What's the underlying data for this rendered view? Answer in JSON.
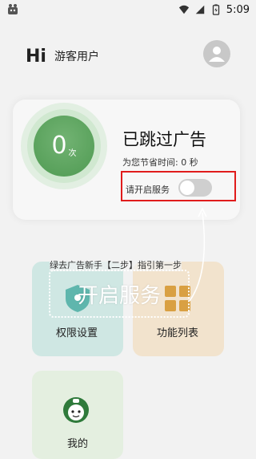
{
  "status_bar": {
    "time": "5:09"
  },
  "header": {
    "greeting": "Hi",
    "username": "游客用户"
  },
  "stats": {
    "count": "0",
    "count_unit": "次",
    "title": "已跳过广告",
    "saved_time": "为您节省时间: 0 秒",
    "service_label": "请开启服务",
    "service_enabled": false
  },
  "guide": {
    "step_text": "绿去广告新手【二步】指引第一步",
    "button_label": "开启服务"
  },
  "tiles": {
    "permissions": "权限设置",
    "features": "功能列表",
    "mine": "我的"
  },
  "colors": {
    "accent_green": "#4f9a52",
    "highlight_red": "#e01c1c",
    "tile_teal": "#cfe7e3",
    "tile_orange": "#f2e3cd",
    "tile_green": "#e4efe0"
  }
}
